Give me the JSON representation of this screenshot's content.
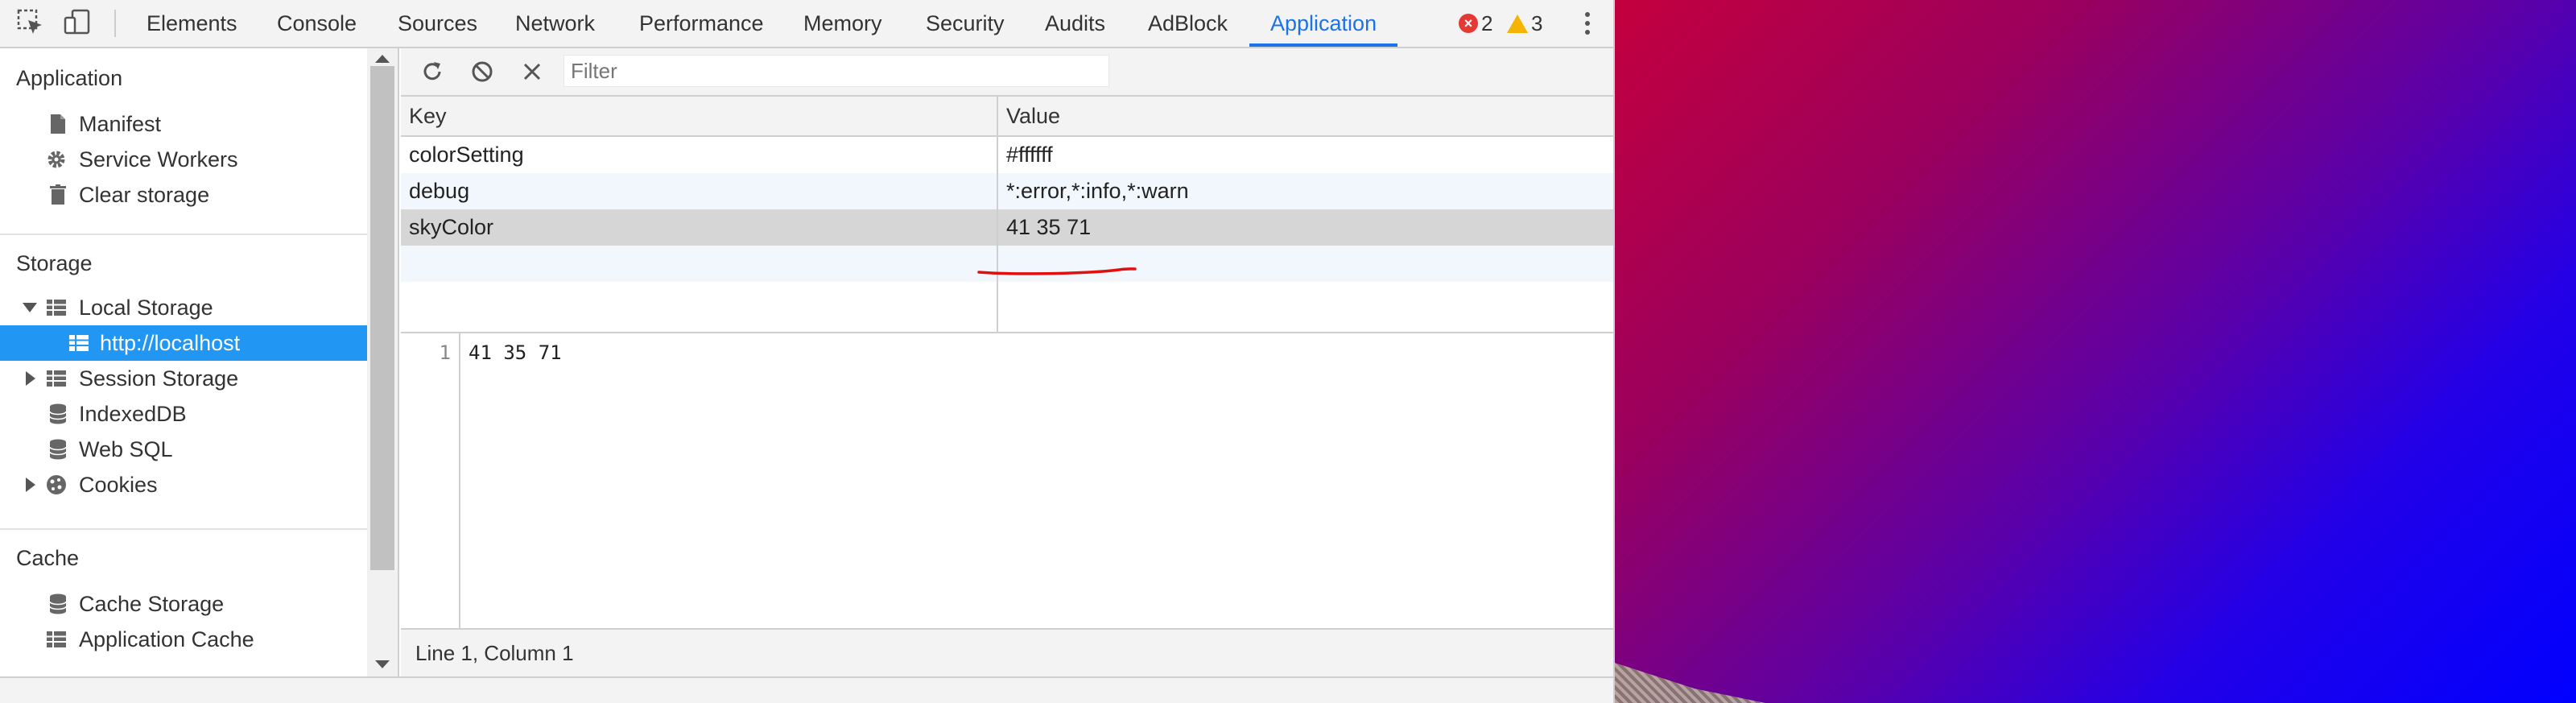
{
  "toolbar": {
    "tabs": [
      {
        "label": "Elements"
      },
      {
        "label": "Console"
      },
      {
        "label": "Sources"
      },
      {
        "label": "Network"
      },
      {
        "label": "Performance"
      },
      {
        "label": "Memory"
      },
      {
        "label": "Security"
      },
      {
        "label": "Audits"
      },
      {
        "label": "AdBlock"
      },
      {
        "label": "Application"
      }
    ],
    "active_tab": "Application",
    "errors": "2",
    "warnings": "3",
    "icons": [
      "inspect-element-icon",
      "device-toolbar-icon",
      "more-options-icon"
    ]
  },
  "sidebar": {
    "sections": [
      {
        "title": "Application",
        "items": [
          {
            "label": "Manifest",
            "icon": "document-icon"
          },
          {
            "label": "Service Workers",
            "icon": "gear-icon"
          },
          {
            "label": "Clear storage",
            "icon": "trash-icon"
          }
        ]
      },
      {
        "title": "Storage",
        "items": [
          {
            "label": "Local Storage",
            "icon": "grid-icon",
            "expanded": true
          },
          {
            "label": "http://localhost",
            "icon": "grid-icon",
            "selected": true
          },
          {
            "label": "Session Storage",
            "icon": "grid-icon",
            "expanded": false
          },
          {
            "label": "IndexedDB",
            "icon": "database-icon"
          },
          {
            "label": "Web SQL",
            "icon": "database-icon"
          },
          {
            "label": "Cookies",
            "icon": "cookie-icon",
            "expanded": false
          }
        ]
      },
      {
        "title": "Cache",
        "items": [
          {
            "label": "Cache Storage",
            "icon": "database-icon"
          },
          {
            "label": "Application Cache",
            "icon": "grid-icon"
          }
        ]
      }
    ]
  },
  "main": {
    "toolbar": {
      "icons": [
        "refresh-icon",
        "clear-all-icon",
        "delete-icon"
      ],
      "filter_placeholder": "Filter"
    },
    "table": {
      "headers": [
        "Key",
        "Value"
      ],
      "rows": [
        {
          "key": "colorSetting",
          "value": "#ffffff"
        },
        {
          "key": "debug",
          "value": "*:error,*:info,*:warn"
        },
        {
          "key": "skyColor",
          "value": "41 35 71",
          "selected": true
        }
      ]
    },
    "preview": {
      "line_number": "1",
      "content": "41 35 71"
    },
    "status": "Line 1, Column 1"
  },
  "colors": {
    "accent": "#1a73e8",
    "selection": "#2196f3",
    "annotation": "#e01010"
  }
}
